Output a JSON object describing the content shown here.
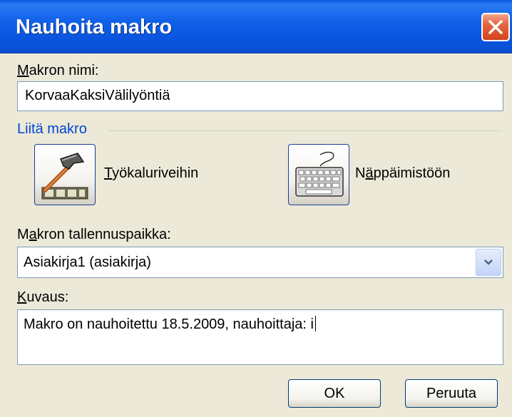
{
  "window": {
    "title": "Nauhoita makro"
  },
  "macro_name": {
    "label_first": "M",
    "label_rest": "akron nimi:",
    "value": "KorvaaKaksiVälilyöntiä"
  },
  "assign": {
    "group_label": "Liitä makro",
    "toolbar_button": {
      "label_first": "T",
      "label_rest": "yökaluriveihin"
    },
    "keyboard_button": {
      "label_pre": "N",
      "label_key": "ä",
      "label_rest": "ppäimistöön"
    }
  },
  "store_in": {
    "label_pre": "M",
    "label_key": "a",
    "label_rest": "kron tallennuspaikka:",
    "value": "Asiakirja1 (asiakirja)"
  },
  "description": {
    "label_first": "K",
    "label_rest": "uvaus:",
    "value": "Makro on nauhoitettu 18.5.2009, nauhoittaja: i"
  },
  "buttons": {
    "ok": "OK",
    "cancel": "Peruuta"
  }
}
